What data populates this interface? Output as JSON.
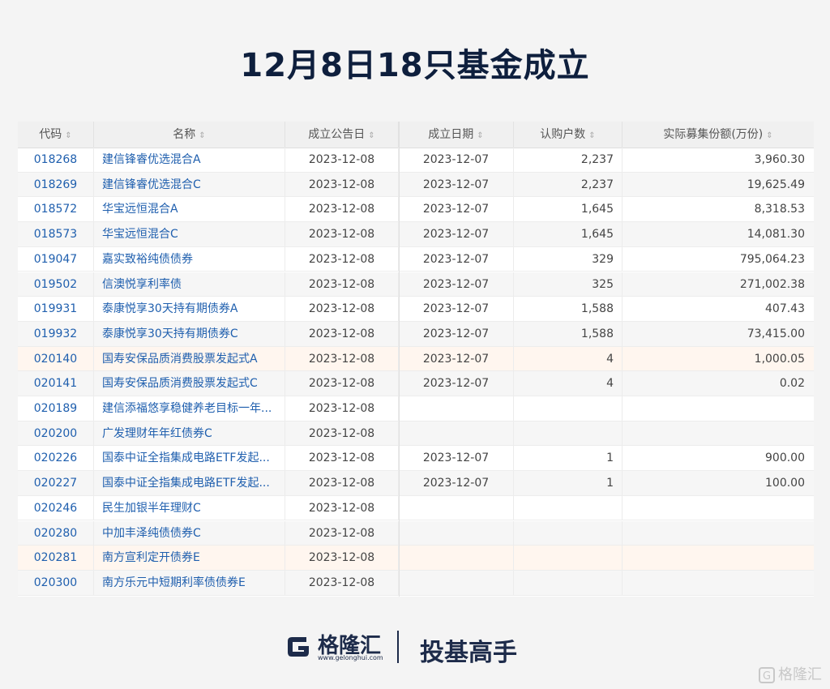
{
  "title": "12月8日18只基金成立",
  "table": {
    "headers": {
      "code": "代码",
      "name": "名称",
      "announce_date": "成立公告日",
      "establish_date": "成立日期",
      "subscribers": "认购户数",
      "amount": "实际募集份额(万份)"
    },
    "rows": [
      {
        "code": "018268",
        "name": "建信锋睿优选混合A",
        "announce_date": "2023-12-08",
        "establish_date": "2023-12-07",
        "subscribers": "2,237",
        "amount": "3,960.30"
      },
      {
        "code": "018269",
        "name": "建信锋睿优选混合C",
        "announce_date": "2023-12-08",
        "establish_date": "2023-12-07",
        "subscribers": "2,237",
        "amount": "19,625.49"
      },
      {
        "code": "018572",
        "name": "华宝远恒混合A",
        "announce_date": "2023-12-08",
        "establish_date": "2023-12-07",
        "subscribers": "1,645",
        "amount": "8,318.53"
      },
      {
        "code": "018573",
        "name": "华宝远恒混合C",
        "announce_date": "2023-12-08",
        "establish_date": "2023-12-07",
        "subscribers": "1,645",
        "amount": "14,081.30"
      },
      {
        "code": "019047",
        "name": "嘉实致裕纯债债券",
        "announce_date": "2023-12-08",
        "establish_date": "2023-12-07",
        "subscribers": "329",
        "amount": "795,064.23"
      },
      {
        "code": "019502",
        "name": "信澳悦享利率债",
        "announce_date": "2023-12-08",
        "establish_date": "2023-12-07",
        "subscribers": "325",
        "amount": "271,002.38"
      },
      {
        "code": "019931",
        "name": "泰康悦享30天持有期债券A",
        "announce_date": "2023-12-08",
        "establish_date": "2023-12-07",
        "subscribers": "1,588",
        "amount": "407.43"
      },
      {
        "code": "019932",
        "name": "泰康悦享30天持有期债券C",
        "announce_date": "2023-12-08",
        "establish_date": "2023-12-07",
        "subscribers": "1,588",
        "amount": "73,415.00"
      },
      {
        "code": "020140",
        "name": "国寿安保品质消费股票发起式A",
        "announce_date": "2023-12-08",
        "establish_date": "2023-12-07",
        "subscribers": "4",
        "amount": "1,000.05"
      },
      {
        "code": "020141",
        "name": "国寿安保品质消费股票发起式C",
        "announce_date": "2023-12-08",
        "establish_date": "2023-12-07",
        "subscribers": "4",
        "amount": "0.02"
      },
      {
        "code": "020189",
        "name": "建信添福悠享稳健养老目标一年...",
        "announce_date": "2023-12-08",
        "establish_date": "",
        "subscribers": "",
        "amount": ""
      },
      {
        "code": "020200",
        "name": "广发理财年年红债券C",
        "announce_date": "2023-12-08",
        "establish_date": "",
        "subscribers": "",
        "amount": ""
      },
      {
        "code": "020226",
        "name": "国泰中证全指集成电路ETF发起...",
        "announce_date": "2023-12-08",
        "establish_date": "2023-12-07",
        "subscribers": "1",
        "amount": "900.00"
      },
      {
        "code": "020227",
        "name": "国泰中证全指集成电路ETF发起...",
        "announce_date": "2023-12-08",
        "establish_date": "2023-12-07",
        "subscribers": "1",
        "amount": "100.00"
      },
      {
        "code": "020246",
        "name": "民生加银半年理财C",
        "announce_date": "2023-12-08",
        "establish_date": "",
        "subscribers": "",
        "amount": ""
      },
      {
        "code": "020280",
        "name": "中加丰泽纯债债券C",
        "announce_date": "2023-12-08",
        "establish_date": "",
        "subscribers": "",
        "amount": ""
      },
      {
        "code": "020281",
        "name": "南方宣利定开债券E",
        "announce_date": "2023-12-08",
        "establish_date": "",
        "subscribers": "",
        "amount": ""
      },
      {
        "code": "020300",
        "name": "南方乐元中短期利率债债券E",
        "announce_date": "2023-12-08",
        "establish_date": "",
        "subscribers": "",
        "amount": ""
      }
    ]
  },
  "footer": {
    "logo_text": "格隆汇",
    "logo_url": "www.gelonghui.com",
    "slogan": "投基高手",
    "watermark": "格隆汇"
  },
  "colors": {
    "title": "#0e1f3d",
    "link": "#1f5fae",
    "highlight_row": "#fff6ef"
  }
}
